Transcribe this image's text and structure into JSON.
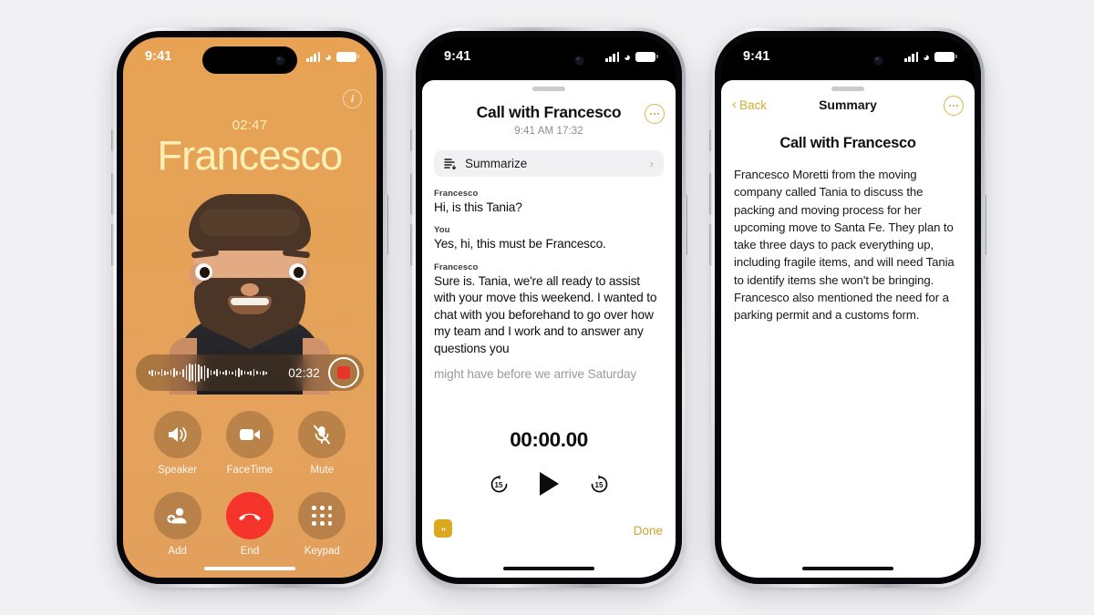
{
  "canvas": {
    "background_color": "#f1f1f4"
  },
  "phone1": {
    "name": "in-call-screen",
    "status_bar": {
      "time": "9:41",
      "wifi_icon": "wifi-icon",
      "cellular_icon": "cellular-bars-icon",
      "battery_icon": "battery-icon"
    },
    "info_button": {
      "icon": "info-circle-icon",
      "label": "i"
    },
    "call_timer": "02:47",
    "caller_name": "Francesco",
    "avatar": "memoji-avatar",
    "recording_pill": {
      "waveform_icon": "audio-waveform",
      "elapsed": "02:32",
      "record_button": "stop-recording-button"
    },
    "controls": [
      {
        "label": "Speaker",
        "icon": "speaker-icon",
        "style": "glass"
      },
      {
        "label": "FaceTime",
        "icon": "video-camera-icon",
        "style": "glass"
      },
      {
        "label": "Mute",
        "icon": "microphone-slash-icon",
        "style": "glass"
      },
      {
        "label": "Add",
        "icon": "add-person-icon",
        "style": "glass"
      },
      {
        "label": "End",
        "icon": "end-call-icon",
        "style": "red"
      },
      {
        "label": "Keypad",
        "icon": "keypad-grid-icon",
        "style": "glass"
      }
    ],
    "colors": {
      "background": "#e5a257",
      "name_text": "#fdf0b4",
      "end_button": "#f5352b",
      "record_dot": "#e8352b"
    }
  },
  "phone2": {
    "name": "call-transcript-sheet",
    "status_bar": {
      "time": "9:41"
    },
    "title": "Call with Francesco",
    "subtitle": "9:41 AM  17:32",
    "more_button": "ellipsis-circle-button",
    "summarize_row": {
      "icon": "summarize-icon",
      "label": "Summarize",
      "chevron": "chevron-right-icon"
    },
    "transcript": [
      {
        "speaker": "Francesco",
        "text": "Hi, is this Tania?",
        "faded": false
      },
      {
        "speaker": "You",
        "text": "Yes, hi, this must be Francesco.",
        "faded": false
      },
      {
        "speaker": "Francesco",
        "text": "Sure is. Tania, we're all ready to assist with your move this weekend. I wanted to chat with you beforehand to go over how my team and I work and to answer any questions you",
        "faded": false
      },
      {
        "speaker": "",
        "text": "might have before we arrive Saturday",
        "faded": true
      }
    ],
    "player": {
      "time": "00:00.00",
      "back_label": "15",
      "forward_label": "15",
      "play_icon": "play-triangle-icon"
    },
    "captions_button": "live-captions-button",
    "done_button": "Done",
    "colors": {
      "accent": "#cca22b",
      "captions_bg": "#d9a81f"
    }
  },
  "phone3": {
    "name": "call-summary-sheet",
    "status_bar": {
      "time": "9:41"
    },
    "back_label": "Back",
    "nav_title": "Summary",
    "more_button": "ellipsis-circle-button",
    "heading": "Call with Francesco",
    "body": "Francesco Moretti from the moving company called Tania to discuss the packing and moving process for her upcoming move to Santa Fe. They plan to take three days to pack everything up, including fragile items, and will need Tania to identify items she won't be bringing. Francesco also mentioned the need for a parking permit and a customs form.",
    "colors": {
      "accent": "#d4ab33"
    }
  }
}
